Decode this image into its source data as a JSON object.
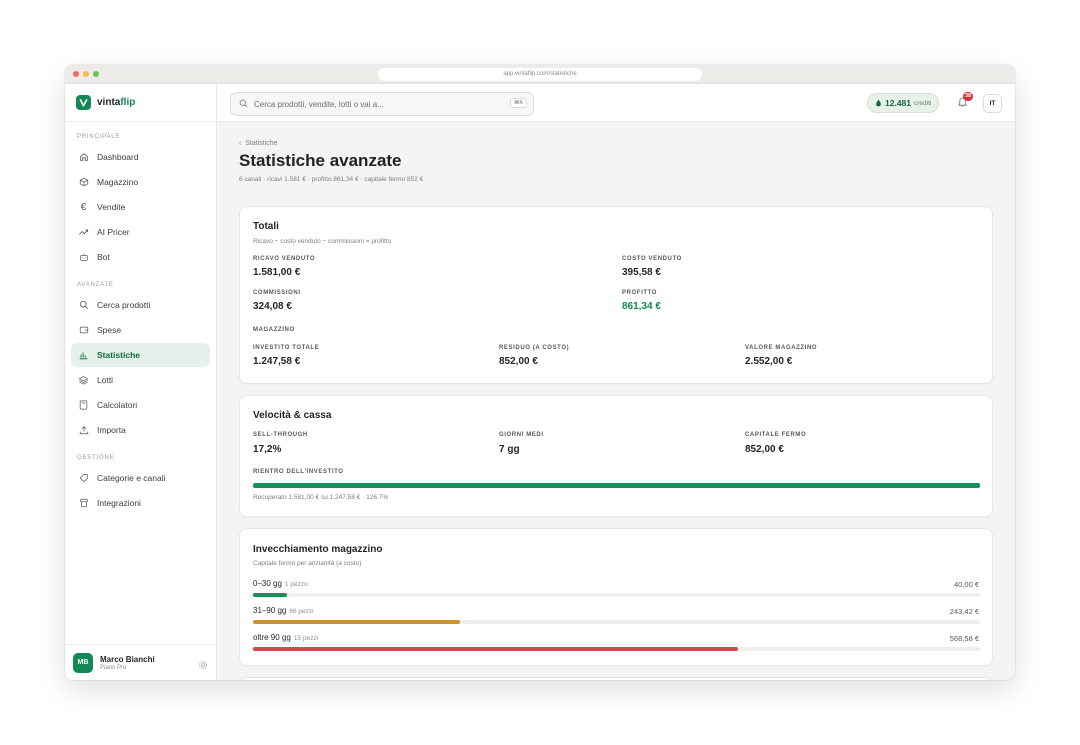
{
  "browser": {
    "url": "app.vintaflip.com/statistiche"
  },
  "app": {
    "brand_a": "vinta",
    "brand_b": "flip",
    "accent": "#138a56"
  },
  "sidebar": {
    "sections": [
      {
        "title": "PRINCIPALE",
        "items": [
          {
            "label": "Dashboard",
            "icon": "home-icon"
          },
          {
            "label": "Magazzino",
            "icon": "box-icon"
          },
          {
            "label": "Vendite",
            "icon": "euro-icon"
          },
          {
            "label": "AI Pricer",
            "icon": "trend-icon"
          },
          {
            "label": "Bot",
            "icon": "bot-icon"
          }
        ]
      },
      {
        "title": "AVANZATE",
        "items": [
          {
            "label": "Cerca prodotti",
            "icon": "search-icon"
          },
          {
            "label": "Spese",
            "icon": "wallet-icon"
          },
          {
            "label": "Statistiche",
            "icon": "chart-icon",
            "active": true
          },
          {
            "label": "Lotti",
            "icon": "layers-icon"
          },
          {
            "label": "Calcolatori",
            "icon": "calculator-icon"
          },
          {
            "label": "Importa",
            "icon": "upload-icon"
          }
        ]
      },
      {
        "title": "GESTIONE",
        "items": [
          {
            "label": "Categorie e canali",
            "icon": "tag-icon"
          },
          {
            "label": "Integrazioni",
            "icon": "plug-icon"
          }
        ]
      }
    ],
    "user": {
      "initials": "MB",
      "name": "Marco Bianchi",
      "plan": "Piano Pro"
    }
  },
  "topbar": {
    "search_placeholder": "Cerca prodotti, vendite, lotti o vai a...",
    "shortcut": "⌘K",
    "credits_value": "12.481",
    "credits_label": "crediti",
    "notifications": "38",
    "lang": "IT"
  },
  "page": {
    "breadcrumb": "Statistiche",
    "title": "Statistiche avanzate",
    "subtitle": "6 canali · ricavi 1.581 € · profitto 861,34 € · capitale fermo 852 €"
  },
  "totali": {
    "title": "Totali",
    "formula": "Ricavo − costo venduto − commissioni = profitto",
    "ricavo_label": "RICAVO VENDUTO",
    "ricavo_value": "1.581,00 €",
    "costo_label": "COSTO VENDUTO",
    "costo_value": "395,58 €",
    "commissioni_label": "COMMISSIONI",
    "commissioni_value": "324,08 €",
    "profitto_label": "PROFITTO",
    "profitto_value": "861,34 €",
    "magazzino_label": "MAGAZZINO",
    "investito_label": "INVESTITO TOTALE",
    "investito_value": "1.247,58 €",
    "residuo_label": "RESIDUO (A COSTO)",
    "residuo_value": "852,00 €",
    "valore_label": "VALORE MAGAZZINO",
    "valore_value": "2.552,00 €"
  },
  "velocita": {
    "title": "Velocità & cassa",
    "sell_label": "SELL-THROUGH",
    "sell_value": "17,2%",
    "giorni_label": "GIORNI MEDI",
    "giorni_value": "7 gg",
    "capitale_label": "CAPITALE FERMO",
    "capitale_value": "852,00 €",
    "rientro_label": "RIENTRO DELL'INVESTITO",
    "rientro_progress": 1.0,
    "rientro_note": "Recuperato 1.581,00 € su 1.247,58 € · 126.7%"
  },
  "invecchiamento": {
    "title": "Invecchiamento magazzino",
    "subtitle": "Capitale fermo per anzianità (a costo)",
    "rows": [
      {
        "range": "0–30 gg",
        "count": "1 pezzo",
        "value": "40,00 €",
        "fraction": 0.047,
        "color": "#12915a"
      },
      {
        "range": "31–90 gg",
        "count": "66 pezzi",
        "value": "243,42 €",
        "fraction": 0.285,
        "color": "#c8952a"
      },
      {
        "range": "oltre 90 gg",
        "count": "15 pezzi",
        "value": "568,58 €",
        "fraction": 0.667,
        "color": "#d9474c"
      }
    ]
  }
}
